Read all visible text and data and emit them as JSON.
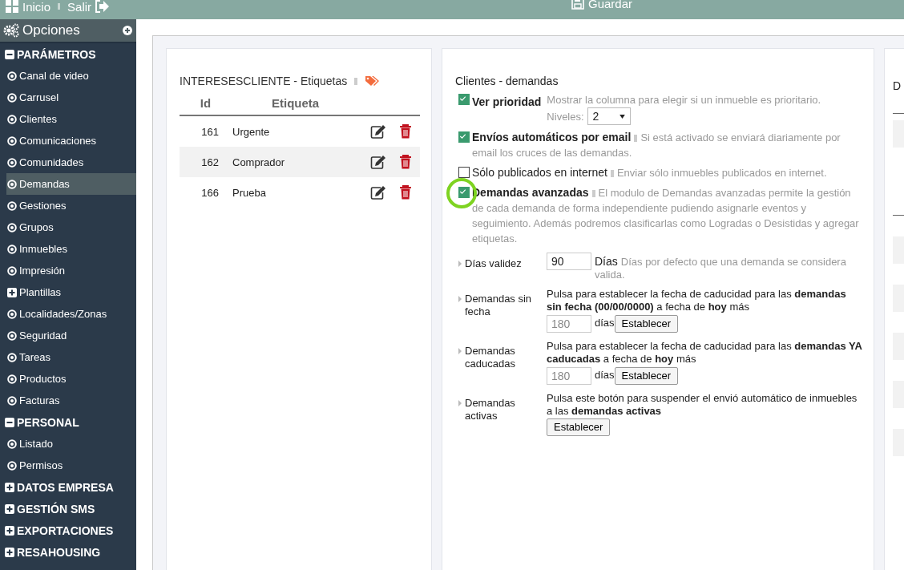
{
  "topbar": {
    "links": [
      {
        "kind": "home",
        "label": "Inicio"
      },
      {
        "kind": "exit",
        "label": "Salir"
      }
    ],
    "save": "Guardar"
  },
  "sidebar": {
    "title": "Opciones",
    "sections": [
      {
        "label": "PARÁMETROS",
        "expanded": true,
        "items": [
          {
            "kind": "link",
            "label": "Canal de video",
            "selected": false
          },
          {
            "kind": "link",
            "label": "Carrusel",
            "selected": false
          },
          {
            "kind": "link",
            "label": "Clientes",
            "selected": false
          },
          {
            "kind": "link",
            "label": "Comunicaciones",
            "selected": false
          },
          {
            "kind": "link",
            "label": "Comunidades",
            "selected": false
          },
          {
            "kind": "link",
            "label": "Demandas",
            "selected": true
          },
          {
            "kind": "link",
            "label": "Gestiones",
            "selected": false
          },
          {
            "kind": "link",
            "label": "Grupos",
            "selected": false
          },
          {
            "kind": "link",
            "label": "Inmuebles",
            "selected": false
          },
          {
            "kind": "link",
            "label": "Impresión",
            "selected": false
          },
          {
            "kind": "group",
            "label": "Plantillas",
            "selected": false
          },
          {
            "kind": "link",
            "label": "Localidades/Zonas",
            "selected": false
          },
          {
            "kind": "link",
            "label": "Seguridad",
            "selected": false
          },
          {
            "kind": "link",
            "label": "Tareas",
            "selected": false
          },
          {
            "kind": "link",
            "label": "Productos",
            "selected": false
          },
          {
            "kind": "link",
            "label": "Facturas",
            "selected": false
          }
        ]
      },
      {
        "label": "PERSONAL",
        "expanded": true,
        "items": [
          {
            "kind": "link",
            "label": "Listado",
            "selected": false
          },
          {
            "kind": "link",
            "label": "Permisos",
            "selected": false
          }
        ]
      },
      {
        "label": "DATOS EMPRESA",
        "expanded": false
      },
      {
        "label": "GESTIÓN SMS",
        "expanded": false
      },
      {
        "label": "EXPORTACIONES",
        "expanded": false
      },
      {
        "label": "RESAHOUSING",
        "expanded": false
      }
    ]
  },
  "tags_panel": {
    "title": "INTERESESCLIENTE - Etiquetas",
    "columns": [
      "Id",
      "Etiqueta"
    ],
    "rows": [
      {
        "id": "161",
        "label": "Urgente"
      },
      {
        "id": "162",
        "label": "Comprador"
      },
      {
        "id": "166",
        "label": "Prueba"
      }
    ]
  },
  "demands_panel": {
    "title": "Clientes - demandas",
    "options": [
      {
        "label": "Ver prioridad",
        "checked": true,
        "description": "Mostrar la columna para elegir si un inmueble es prioritario.",
        "levels_label": "Niveles:",
        "levels_value": "2"
      },
      {
        "label": "Envíos automáticos por email",
        "checked": true,
        "description": "Si está activado se enviará diariamente por email los cruces de las demandas."
      },
      {
        "label": "Sólo publicados en internet",
        "checked": false,
        "description": "Enviar sólo inmuebles publicados en internet."
      },
      {
        "label": "Demandas avanzadas",
        "checked": true,
        "highlighted": true,
        "description": "El modulo de Demandas avanzadas permite la gestión de cada demanda de forma independiente pudiendo asignarle eventos y seguimiento. Además podremos clasificarlas como Logradas o Desistidas y agregar etiquetas."
      }
    ],
    "params": [
      {
        "kind": "days",
        "label": "Días validez",
        "value": "90",
        "unit": "Días",
        "description": "Días por defecto que una demanda se considera valida."
      },
      {
        "kind": "action",
        "label": "Demandas sin fecha",
        "text": "Pulsa para establecer la fecha de caducidad para las **demandas sin fecha (00/00/0000)** a fecha de **hoy** más",
        "placeholder": "180",
        "unit": "días",
        "button": "Establecer"
      },
      {
        "kind": "action",
        "label": "Demandas caducadas",
        "text": "Pulsa para establecer la fecha de caducidad para las **demandas YA caducadas** a fecha de **hoy** más",
        "placeholder": "180",
        "unit": "días",
        "button": "Establecer"
      },
      {
        "kind": "action",
        "label": "Demandas activas",
        "text": "Pulsa este botón para suspender el envió automático de inmuebles a las **demandas activas**",
        "button": "Establecer"
      }
    ]
  },
  "column_3": {
    "title": "D"
  }
}
